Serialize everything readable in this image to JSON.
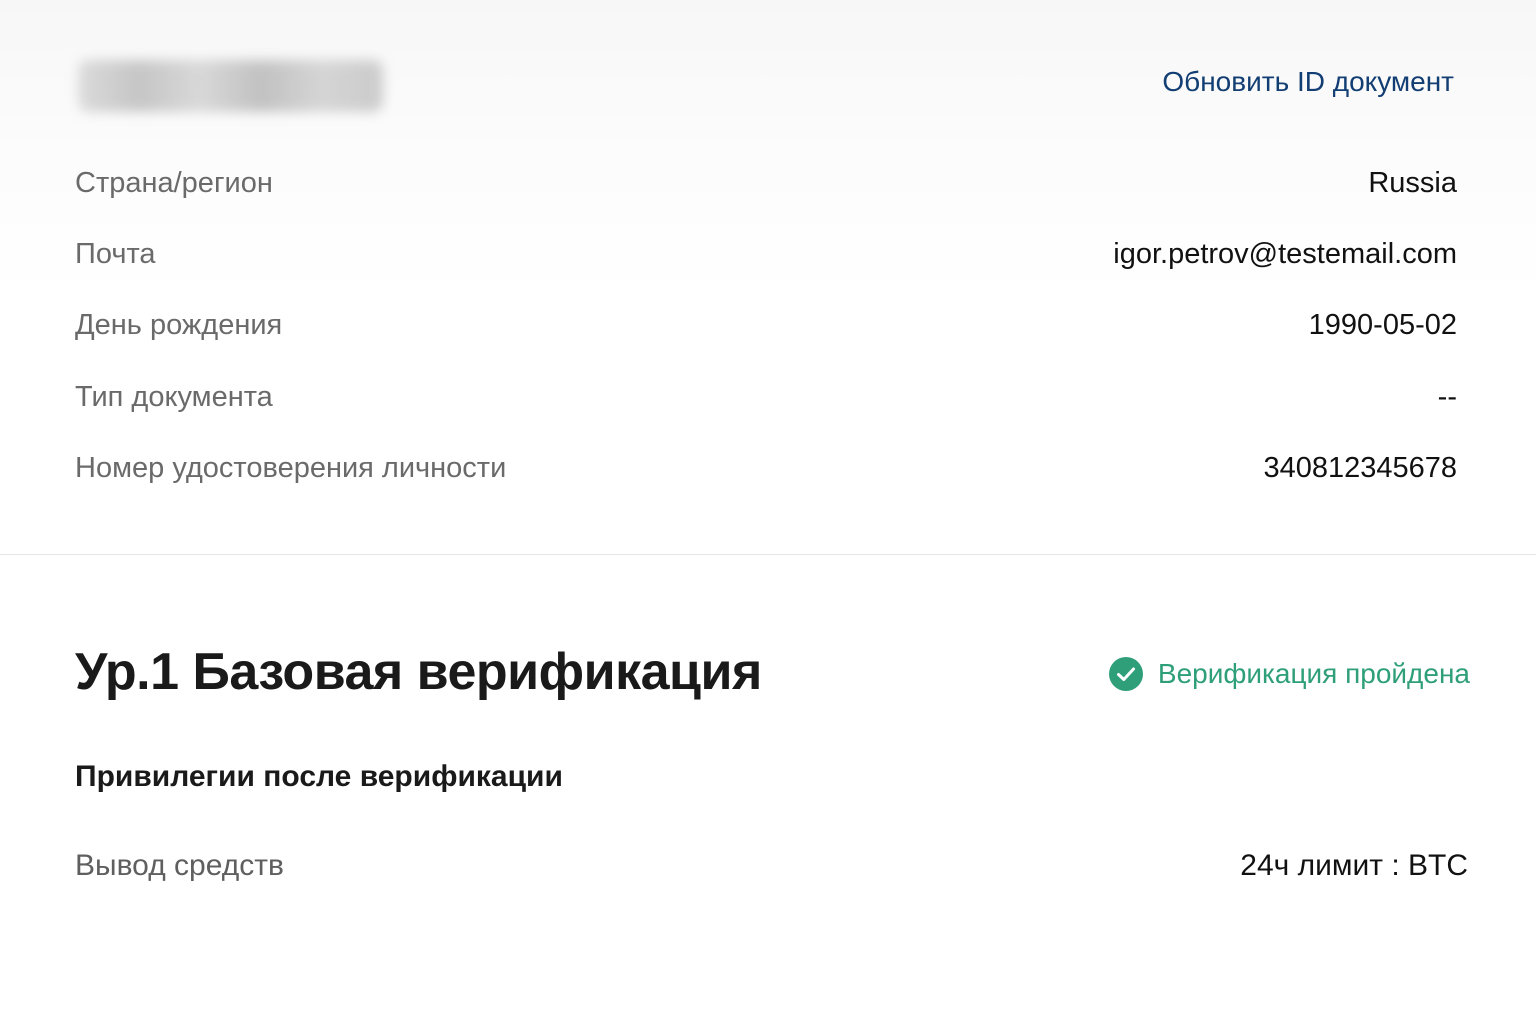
{
  "profile": {
    "update_link": "Обновить ID документ"
  },
  "info": [
    {
      "label": "Страна/регион",
      "value": "Russia"
    },
    {
      "label": "Почта",
      "value": "igor.petrov@testemail.com"
    },
    {
      "label": "День рождения",
      "value": "1990-05-02"
    },
    {
      "label": "Тип документа",
      "value": "--"
    },
    {
      "label": "Номер удостоверения личности",
      "value": "340812345678"
    }
  ],
  "level": {
    "title": "Ур.1 Базовая верификация",
    "status": "Верификация пройдена",
    "status_icon": "check-circle-icon",
    "status_color": "#2e9f78"
  },
  "privileges": {
    "title": "Привилегии после верификации",
    "items": [
      {
        "label": "Вывод средств",
        "value": "24ч лимит : BTC"
      }
    ]
  },
  "colors": {
    "link": "#123e73",
    "success": "#2e9f78"
  }
}
